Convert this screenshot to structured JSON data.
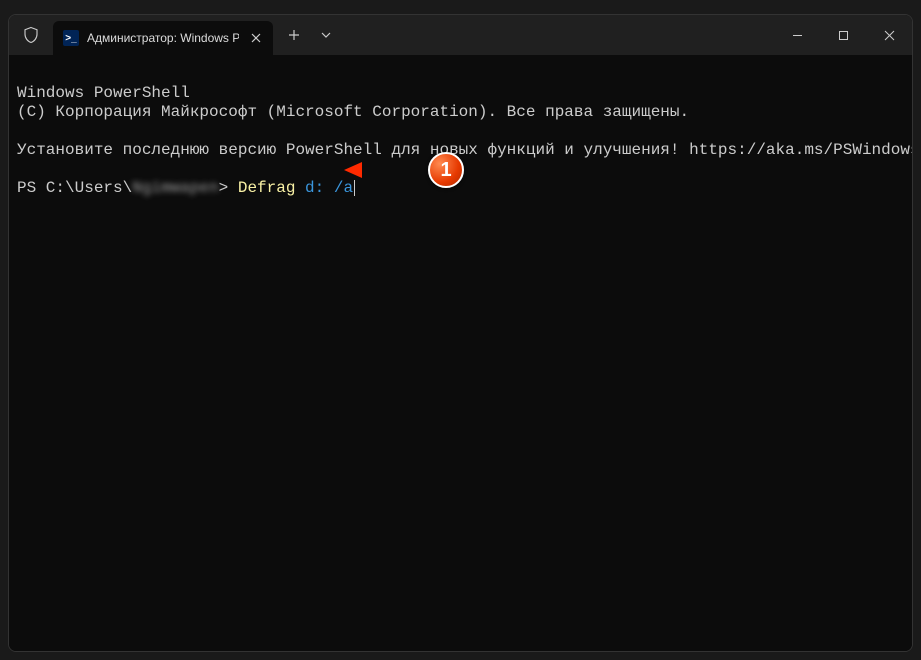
{
  "window": {
    "tab_title": "Администратор: Windows Pc",
    "shield_icon": "shield",
    "ps_icon_text": ">_"
  },
  "terminal": {
    "line1": "Windows PowerShell",
    "line2": "(C) Корпорация Майкрософт (Microsoft Corporation). Все права защищены.",
    "line3_a": "Установите последнюю версию PowerShell для новых функций и улучшения! ",
    "line3_b": "https://aka.ms/PSWindows",
    "prompt_prefix": "PS C:\\Users\\",
    "prompt_user_blurred": "Ngimмapen",
    "prompt_suffix": "> ",
    "command_word": "Defrag",
    "command_args": " d: /a"
  },
  "annotation": {
    "number": "1"
  }
}
